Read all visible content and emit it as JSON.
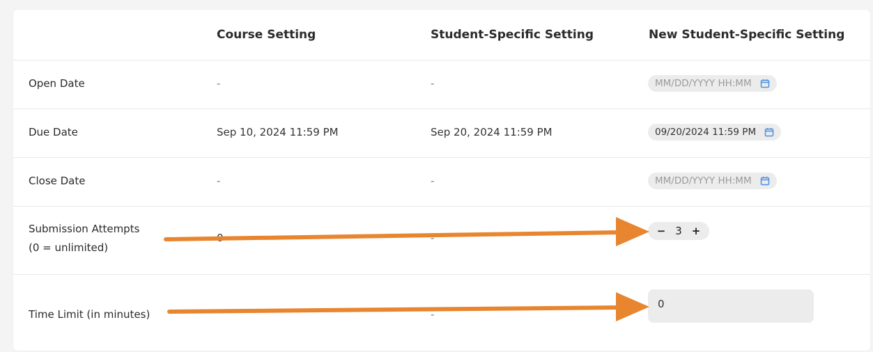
{
  "table": {
    "headers": {
      "label": "",
      "course": "Course Setting",
      "student": "Student-Specific Setting",
      "new_student": "New Student-Specific Setting"
    },
    "rows": {
      "open_date": {
        "label": "Open Date",
        "course": "-",
        "student": "-",
        "new_placeholder": "MM/DD/YYYY HH:MM"
      },
      "due_date": {
        "label": "Due Date",
        "course": "Sep 10, 2024 11:59 PM",
        "student": "Sep 20, 2024 11:59 PM",
        "new_value": "09/20/2024 11:59 PM"
      },
      "close_date": {
        "label": "Close Date",
        "course": "-",
        "student": "-",
        "new_placeholder": "MM/DD/YYYY HH:MM"
      },
      "submission_attempts": {
        "label_line1": "Submission Attempts",
        "label_line2": "(0 = unlimited)",
        "course": "0",
        "student": "-",
        "new_value": "3",
        "decrement": "−",
        "increment": "+"
      },
      "time_limit": {
        "label": "Time Limit (in minutes)",
        "student": "-",
        "new_value": "0"
      }
    }
  },
  "icons": {
    "calendar": "calendar-icon"
  },
  "colors": {
    "arrow": "#e8852f",
    "calendar_icon": "#4a90e2",
    "pill_background": "#ececec"
  }
}
